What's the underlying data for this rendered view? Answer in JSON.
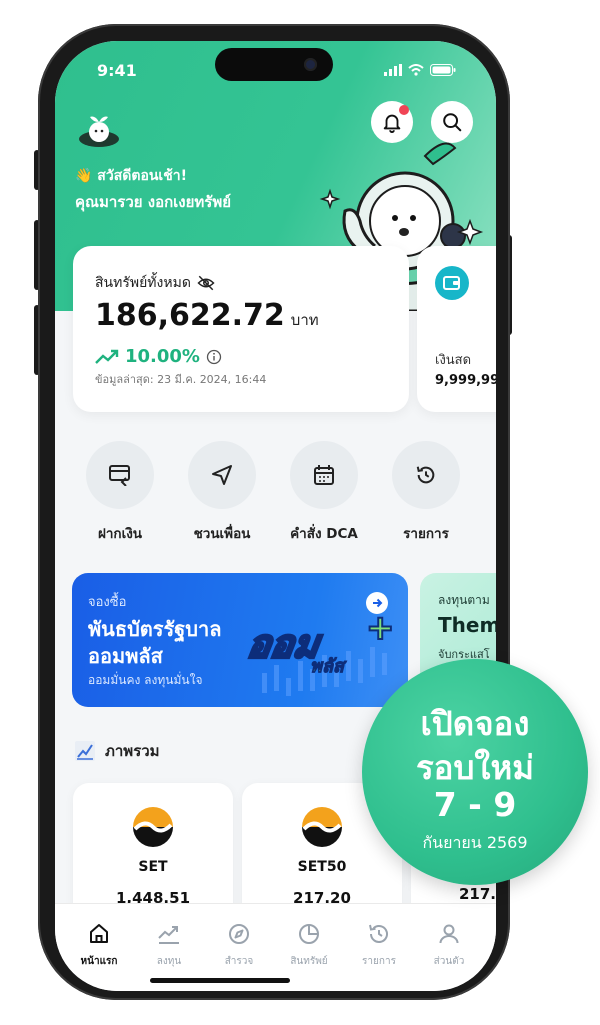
{
  "status_bar": {
    "time": "9:41"
  },
  "header": {
    "greeting": "👋 สวัสดีตอนเช้า!",
    "user_name": "คุณมารวย งอกเงยทรัพย์"
  },
  "assets_card": {
    "label": "สินทรัพย์ทั้งหมด",
    "amount": "186,622.72",
    "unit": "บาท",
    "change": "10.00%",
    "updated": "ข้อมูลล่าสุด: 23 มี.ค. 2024, 16:44"
  },
  "cash_card": {
    "label": "เงินสด",
    "amount": "9,999,99"
  },
  "quick_actions": [
    {
      "label": "ฝากเงิน",
      "icon": "deposit-icon"
    },
    {
      "label": "ชวนเพื่อน",
      "icon": "send-icon"
    },
    {
      "label": "คำสั่ง DCA",
      "icon": "calendar-icon"
    },
    {
      "label": "รายการ",
      "icon": "history-icon"
    }
  ],
  "banner_main": {
    "tag": "จองซื้อ",
    "title_line1": "พันธบัตรรัฐบาล",
    "title_line2": "ออมพลัส",
    "subtitle": "ออมมั่นคง ลงทุนมั่นใจ",
    "logo_text": "ออม",
    "logo_sub": "พลัส"
  },
  "banner_side": {
    "tag": "ลงทุนตาม",
    "title": "Thema",
    "subtitle": "จับกระแสโ"
  },
  "overview": {
    "title": "ภาพรวม"
  },
  "indices": [
    {
      "name": "SET",
      "value": "1,448.51"
    },
    {
      "name": "SET50",
      "value": "217.20"
    },
    {
      "name": "",
      "value": "217."
    }
  ],
  "promo_badge": {
    "line1": "เปิดจอง",
    "line2": "รอบใหม่",
    "line3": "7 - 9",
    "line4": "กันยายน 2569"
  },
  "bottom_nav": [
    {
      "label": "หน้าแรก",
      "icon": "home-icon",
      "active": true
    },
    {
      "label": "ลงทุน",
      "icon": "chart-icon"
    },
    {
      "label": "สำรวจ",
      "icon": "compass-icon"
    },
    {
      "label": "สินทรัพย์",
      "icon": "pie-icon"
    },
    {
      "label": "รายการ",
      "icon": "history-icon"
    },
    {
      "label": "ส่วนตัว",
      "icon": "profile-icon"
    }
  ],
  "colors": {
    "brand": "#2fbf8e",
    "accent_green": "#1fb27f",
    "banner_blue": "#1d64e8",
    "notification": "#f04455"
  }
}
